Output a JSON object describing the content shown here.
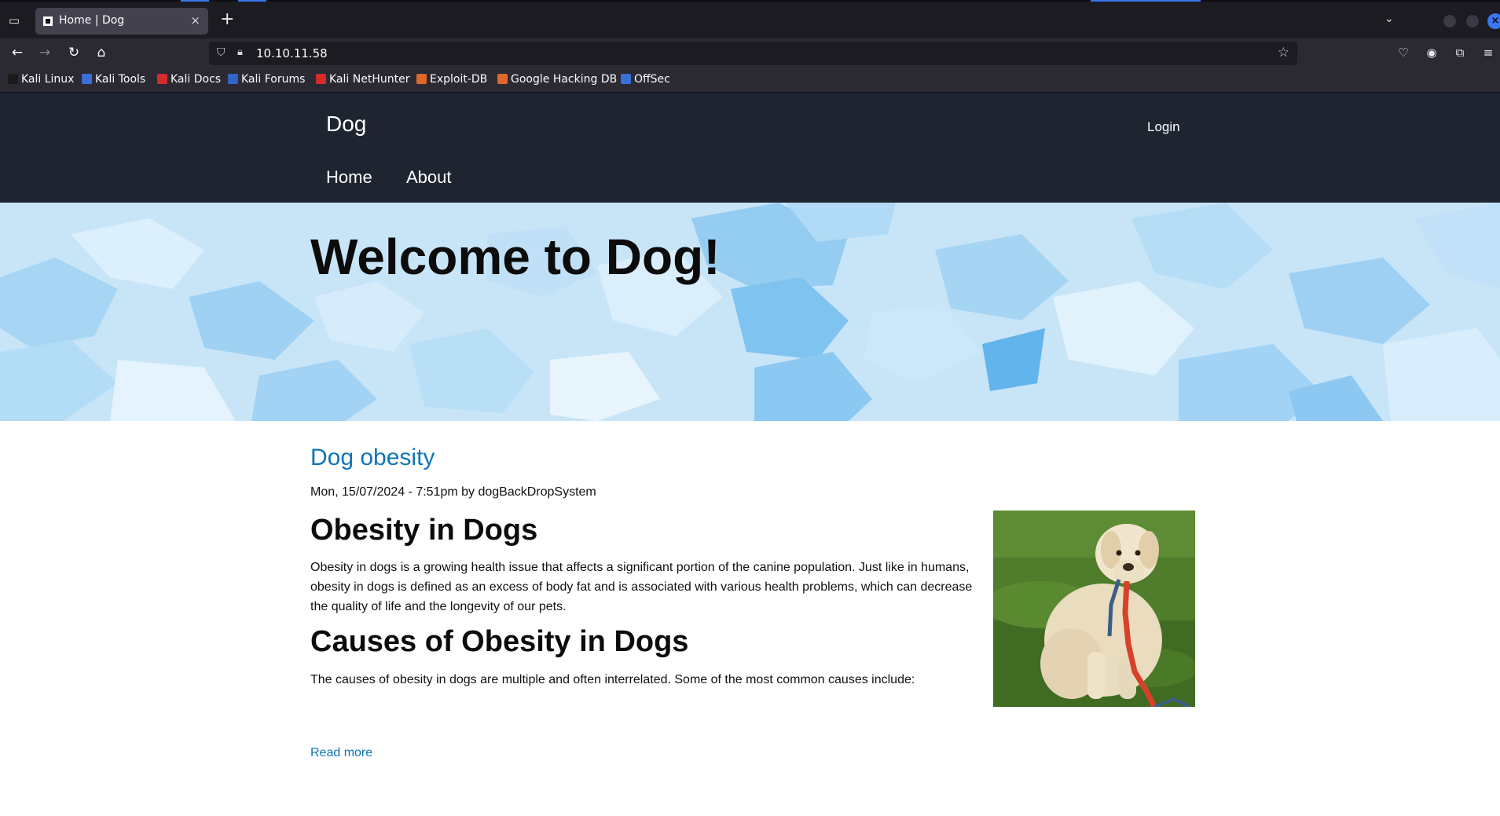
{
  "browser": {
    "tab": {
      "title": "Home | Dog",
      "close_glyph": "×"
    },
    "new_tab_glyph": "+",
    "url": "10.10.11.58",
    "bookmarks": [
      {
        "label": "Kali Linux",
        "color": "#1b1b1b"
      },
      {
        "label": "Kali Tools",
        "color": "#3a6fd8"
      },
      {
        "label": "Kali Docs",
        "color": "#d62b2b"
      },
      {
        "label": "Kali Forums",
        "color": "#2f64c8"
      },
      {
        "label": "Kali NetHunter",
        "color": "#d62b2b"
      },
      {
        "label": "Exploit-DB",
        "color": "#e0662a"
      },
      {
        "label": "Google Hacking DB",
        "color": "#e0662a"
      },
      {
        "label": "OffSec",
        "color": "#3a6fd8"
      }
    ]
  },
  "site": {
    "name": "Dog",
    "login": "Login",
    "menu": [
      "Home",
      "About"
    ],
    "hero_title": "Welcome to Dog!"
  },
  "article": {
    "title": "Dog obesity",
    "meta": "Mon, 15/07/2024 - 7:51pm by dogBackDropSystem",
    "heading1": "Obesity in Dogs",
    "paragraph1": "Obesity in dogs is a growing health issue that affects a significant portion of the canine population. Just like in humans, obesity in dogs is defined as an excess of body fat and is associated with various health problems, which can decrease the quality of life and the longevity of our pets.",
    "heading2": "Causes of Obesity in Dogs",
    "paragraph2": "The causes of obesity in dogs are multiple and often interrelated. Some of the most common causes include:",
    "read_more": "Read more"
  },
  "colors": {
    "header_bg": "#1f2530",
    "link": "#0f75b8",
    "hero_bg": "#c4e3f7"
  }
}
